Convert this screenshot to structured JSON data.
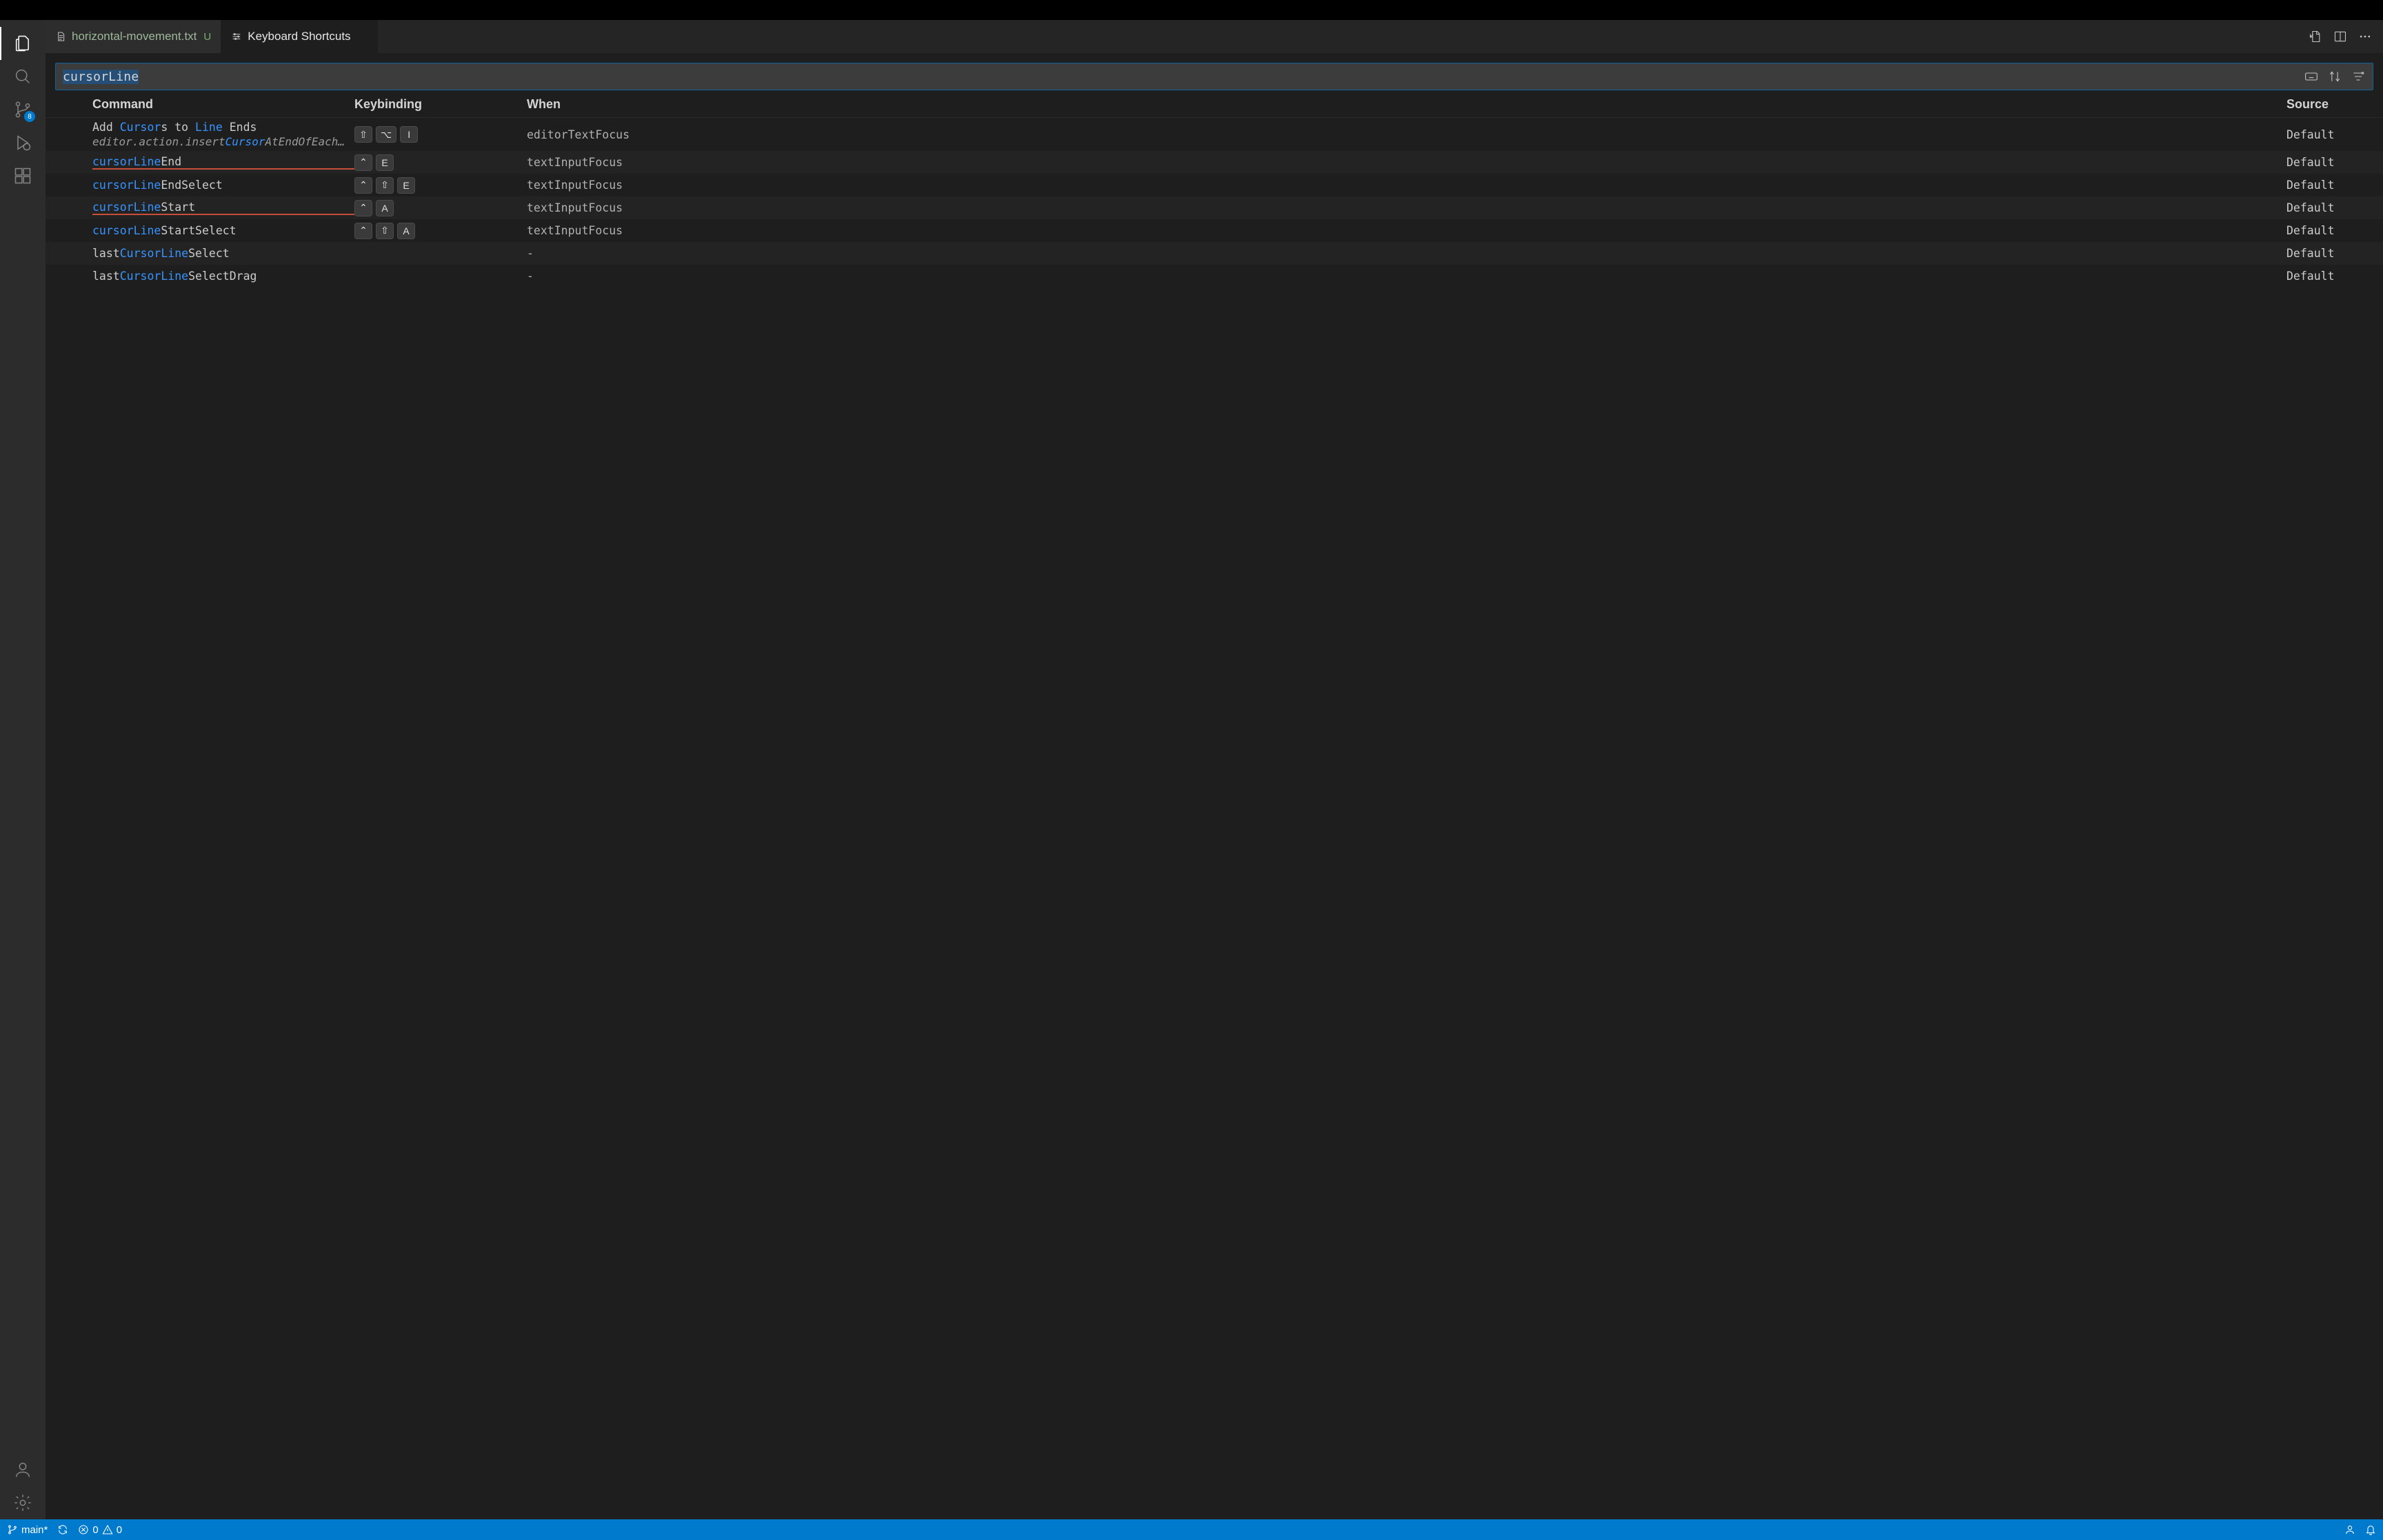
{
  "tabs": [
    {
      "label": "horizontal-movement.txt",
      "modified_flag": "U",
      "active": false
    },
    {
      "label": "Keyboard Shortcuts",
      "active": true
    }
  ],
  "search": {
    "value": "cursorLine"
  },
  "columns": {
    "command": "Command",
    "keybinding": "Keybinding",
    "when": "When",
    "source": "Source"
  },
  "rows": [
    {
      "command_parts": [
        "Add ",
        "Cursor",
        "s to ",
        "Line",
        " Ends"
      ],
      "highlight_idx": [
        1,
        3
      ],
      "subtitle_parts": [
        "editor.action.insert",
        "Cursor",
        "AtEndOfEach…"
      ],
      "subtitle_highlight_idx": [
        1
      ],
      "keys": [
        "⇧",
        "⌥",
        "I"
      ],
      "when": "editorTextFocus",
      "source": "Default"
    },
    {
      "command_parts": [
        "cursorLine",
        "End"
      ],
      "highlight_idx": [
        0
      ],
      "spellwarn": true,
      "keys": [
        "⌃",
        "E"
      ],
      "when": "textInputFocus",
      "source": "Default"
    },
    {
      "command_parts": [
        "cursorLine",
        "EndSelect"
      ],
      "highlight_idx": [
        0
      ],
      "keys": [
        "⌃",
        "⇧",
        "E"
      ],
      "when": "textInputFocus",
      "source": "Default"
    },
    {
      "command_parts": [
        "cursorLine",
        "Start"
      ],
      "highlight_idx": [
        0
      ],
      "spellwarn": true,
      "keys": [
        "⌃",
        "A"
      ],
      "when": "textInputFocus",
      "source": "Default"
    },
    {
      "command_parts": [
        "cursorLine",
        "StartSelect"
      ],
      "highlight_idx": [
        0
      ],
      "keys": [
        "⌃",
        "⇧",
        "A"
      ],
      "when": "textInputFocus",
      "source": "Default"
    },
    {
      "command_parts": [
        "last",
        "CursorLine",
        "Select"
      ],
      "highlight_idx": [
        1
      ],
      "keys": [],
      "when": "-",
      "source": "Default"
    },
    {
      "command_parts": [
        "last",
        "CursorLine",
        "SelectDrag"
      ],
      "highlight_idx": [
        1
      ],
      "keys": [],
      "when": "-",
      "source": "Default"
    }
  ],
  "activity": {
    "scm_badge": "8"
  },
  "status": {
    "branch": "main*",
    "errors": "0",
    "warnings": "0"
  }
}
